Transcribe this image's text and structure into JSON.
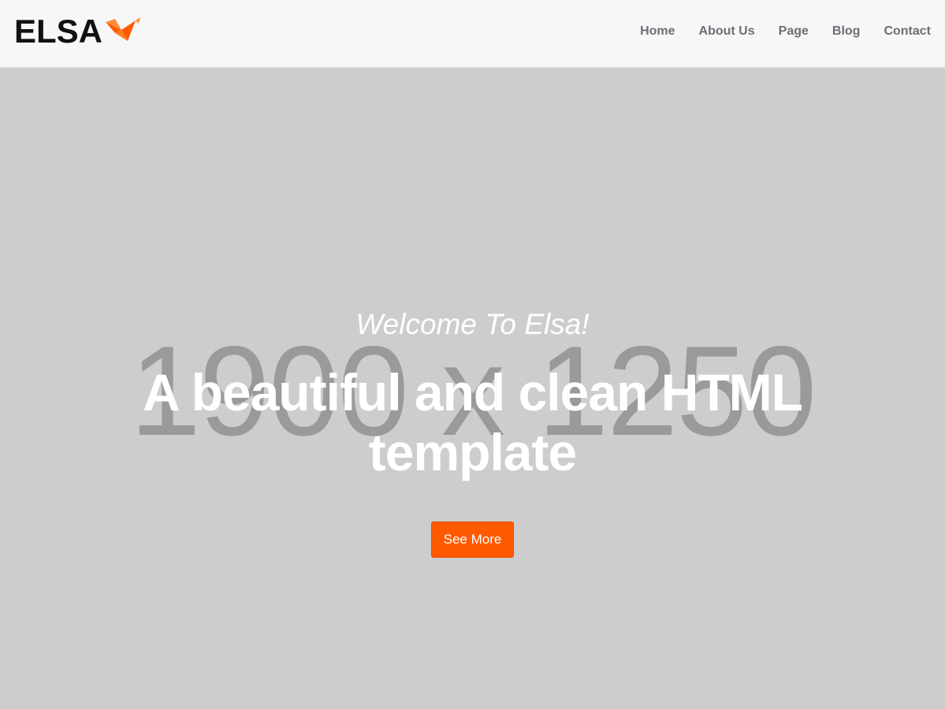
{
  "header": {
    "logo_text": "ELSA",
    "logo_icon": "origami-bird-icon",
    "nav": [
      {
        "label": "Home"
      },
      {
        "label": "About Us"
      },
      {
        "label": "Page"
      },
      {
        "label": "Blog"
      },
      {
        "label": "Contact"
      }
    ]
  },
  "hero": {
    "placeholder_text": "1900 x 1250",
    "subtitle": "Welcome To Elsa!",
    "title": "A beautiful and clean HTML template",
    "button_label": "See More"
  },
  "colors": {
    "accent": "#ff5a00",
    "header_bg": "#f7f7f7",
    "hero_bg": "#cdcdcd",
    "nav_text": "#6a6f75"
  }
}
